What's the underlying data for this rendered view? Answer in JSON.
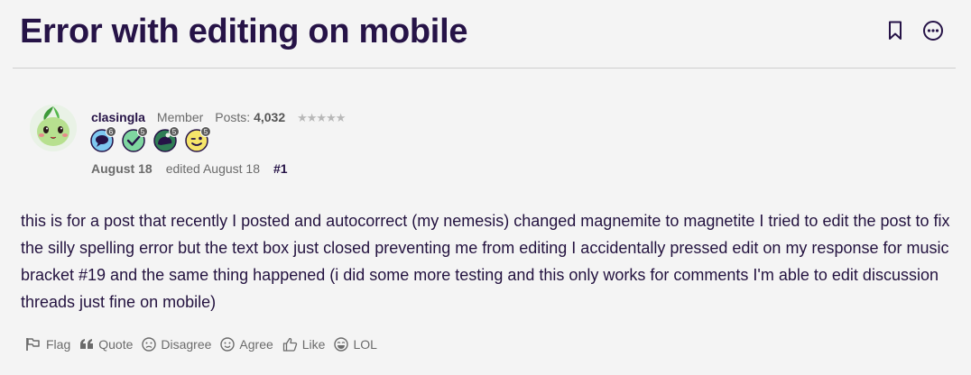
{
  "discussion": {
    "title": "Error with editing on mobile",
    "bookmark_icon": "bookmark-icon",
    "options_icon": "more-options-icon"
  },
  "author": {
    "username": "clasingla",
    "role": "Member",
    "posts_label": "Posts:",
    "posts_count": "4,032",
    "stars": "★★★★★",
    "badges": [
      {
        "icon": "speech-bubble-badge",
        "count": "6",
        "color": "#7ec8f0"
      },
      {
        "icon": "checkmark-badge",
        "count": "5",
        "color": "#7fd6a0"
      },
      {
        "icon": "comment-bubble-badge",
        "count": "5",
        "color": "#2f7d55"
      },
      {
        "icon": "wink-face-badge",
        "count": "5",
        "color": "#f6e56a"
      }
    ]
  },
  "post": {
    "date": "August 18",
    "edited": "edited August 18",
    "permalink": "#1",
    "body": "this is for a post that recently I posted and autocorrect (my nemesis) changed magnemite to magnetite I tried to edit the post to fix the silly spelling error but the text box just closed preventing me from editing I accidentally pressed edit on my response for music bracket #19 and the same thing happened (i did some more testing and this only works for comments I'm able to edit discussion threads just fine on mobile)"
  },
  "reactions": [
    {
      "label": "Flag",
      "icon": "flag-icon"
    },
    {
      "label": "Quote",
      "icon": "quote-icon"
    },
    {
      "label": "Disagree",
      "icon": "disagree-face-icon"
    },
    {
      "label": "Agree",
      "icon": "agree-face-icon"
    },
    {
      "label": "Like",
      "icon": "thumbs-up-icon"
    },
    {
      "label": "LOL",
      "icon": "laughing-face-icon"
    }
  ]
}
